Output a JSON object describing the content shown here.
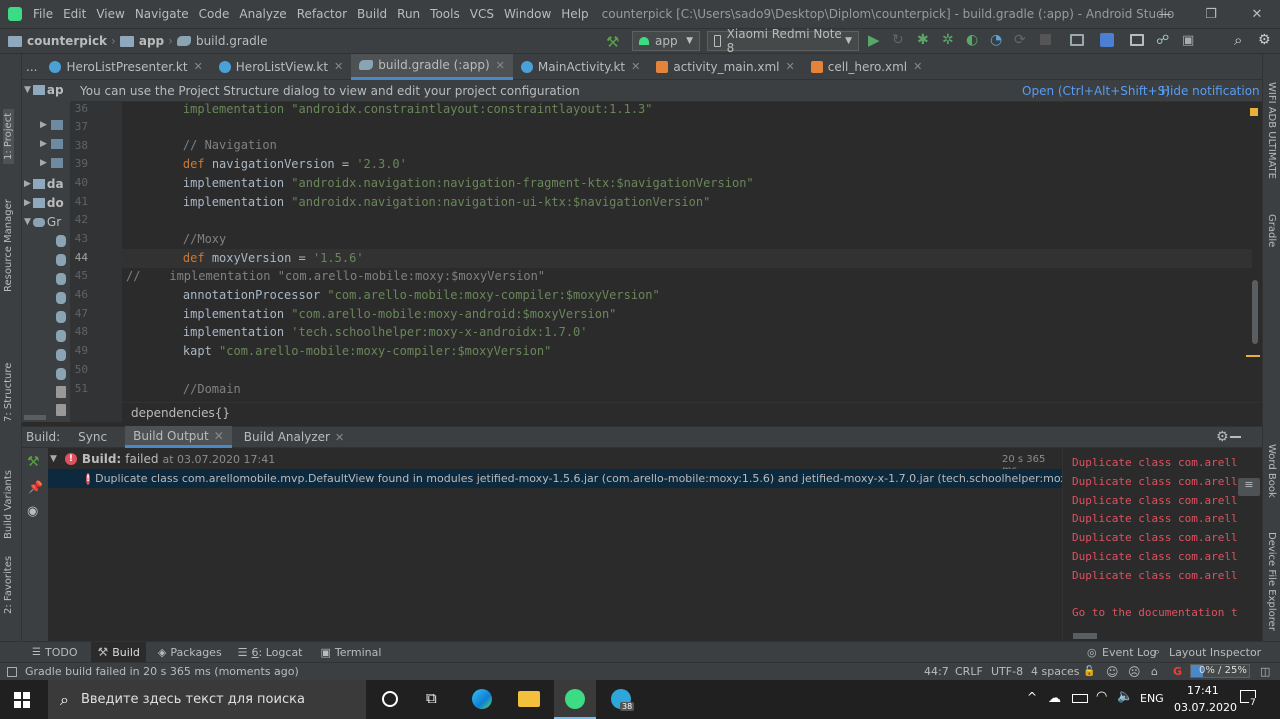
{
  "window": {
    "menu": [
      "File",
      "Edit",
      "View",
      "Navigate",
      "Code",
      "Analyze",
      "Refactor",
      "Build",
      "Run",
      "Tools",
      "VCS",
      "Window",
      "Help"
    ],
    "title": "counterpick [C:\\Users\\sado9\\Desktop\\Diplom\\counterpick] - build.gradle (:app) - Android Studio",
    "minimize": "—",
    "maximize": "❐",
    "close": "✕"
  },
  "breadcrumb": {
    "project": "counterpick",
    "module": "app",
    "file": "build.gradle"
  },
  "toolbar": {
    "run_config": "app",
    "device": "Xiaomi Redmi Note 8"
  },
  "tabs": [
    {
      "label": "HeroListPresenter.kt",
      "kind": "kt"
    },
    {
      "label": "HeroListView.kt",
      "kind": "kt"
    },
    {
      "label": "build.gradle (:app)",
      "kind": "gradle"
    },
    {
      "label": "MainActivity.kt",
      "kind": "kt"
    },
    {
      "label": "activity_main.xml",
      "kind": "xml"
    },
    {
      "label": "cell_hero.xml",
      "kind": "xml"
    }
  ],
  "tabs_overflow": "...",
  "left_tools": {
    "project": "1: Project",
    "resource_manager": "Resource Manager",
    "structure": "7: Structure",
    "build_variants": "Build Variants",
    "favorites": "2: Favorites"
  },
  "right_tools": {
    "wifi_adb": "WIFI ADB ULTIMATE",
    "gradle": "Gradle",
    "word_book": "Word Book",
    "device_explorer": "Device File Explorer"
  },
  "project_tree": [
    "ap",
    "",
    "",
    "",
    "da",
    "do",
    "Gr"
  ],
  "notification": {
    "text": "You can use the Project Structure dialog to view and edit your project configuration",
    "open_action": "Open (Ctrl+Alt+Shift+S)",
    "hide_action": "Hide notification"
  },
  "editor": {
    "lines": [
      {
        "n": "36",
        "text": "    implementation \"androidx.constraintlayout:constraintlayout:1.1.3\""
      },
      {
        "n": "37",
        "text": ""
      },
      {
        "n": "38",
        "text": "    // Navigation"
      },
      {
        "n": "39",
        "text": "    def navigationVersion = '2.3.0'"
      },
      {
        "n": "40",
        "text": "    implementation \"androidx.navigation:navigation-fragment-ktx:$navigationVersion\""
      },
      {
        "n": "41",
        "text": "    implementation \"androidx.navigation:navigation-ui-ktx:$navigationVersion\""
      },
      {
        "n": "42",
        "text": ""
      },
      {
        "n": "43",
        "text": "    //Moxy"
      },
      {
        "n": "44",
        "text": "    def moxyVersion = '1.5.6'"
      },
      {
        "n": "45",
        "text": "//    implementation \"com.arello-mobile:moxy:$moxyVersion\""
      },
      {
        "n": "46",
        "text": "    annotationProcessor \"com.arello-mobile:moxy-compiler:$moxyVersion\""
      },
      {
        "n": "47",
        "text": "    implementation \"com.arello-mobile:moxy-android:$moxyVersion\""
      },
      {
        "n": "48",
        "text": "    implementation 'tech.schoolhelper:moxy-x-androidx:1.7.0'"
      },
      {
        "n": "49",
        "text": "    kapt \"com.arello-mobile:moxy-compiler:$moxyVersion\""
      },
      {
        "n": "50",
        "text": ""
      },
      {
        "n": "51",
        "text": "    //Domain"
      }
    ],
    "breadcrumb": "dependencies{}"
  },
  "build": {
    "label": "Build:",
    "tabs": [
      "Sync",
      "Build Output",
      "Build Analyzer"
    ],
    "status_label": "Build:",
    "status_value": "failed",
    "status_time": "at 03.07.2020 17:41",
    "duration": "20 s 365 ms",
    "error": "Duplicate class com.arellomobile.mvp.DefaultView found in modules jetified-moxy-1.5.6.jar (com.arello-mobile:moxy:1.5.6) and jetified-moxy-x-1.7.0.jar (tech.schoolhelper:moxy-x:1.7.0)",
    "output_lines": [
      "Duplicate class com.arell",
      "Duplicate class com.arell",
      "Duplicate class com.arell",
      "Duplicate class com.arell",
      "Duplicate class com.arell",
      "Duplicate class com.arell",
      "Duplicate class com.arell"
    ],
    "doc_link": "Go to the documentation t"
  },
  "bottom_tools": {
    "todo": "TODO",
    "build": "Build",
    "packages": "Packages",
    "logcat_num": "6",
    "logcat": ": Logcat",
    "terminal": "Terminal",
    "event_log": "Event Log",
    "layout_inspector": "Layout Inspector"
  },
  "status": {
    "message": "Gradle build failed in 20 s 365 ms (moments ago)",
    "position": "44:7",
    "line_sep": "CRLF",
    "encoding": "UTF-8",
    "indent": "4 spaces",
    "memory": "0% / 25%"
  },
  "taskbar": {
    "search_placeholder": "Введите здесь текст для поиска",
    "lang": "ENG",
    "time": "17:41",
    "date": "03.07.2020",
    "telegram_badge": "38",
    "notif_count": "7"
  },
  "colors": {
    "accent": "#4a88c7",
    "error": "#e0515f",
    "keyword": "#cc7832",
    "string": "#6a8759",
    "comment": "#808080"
  }
}
